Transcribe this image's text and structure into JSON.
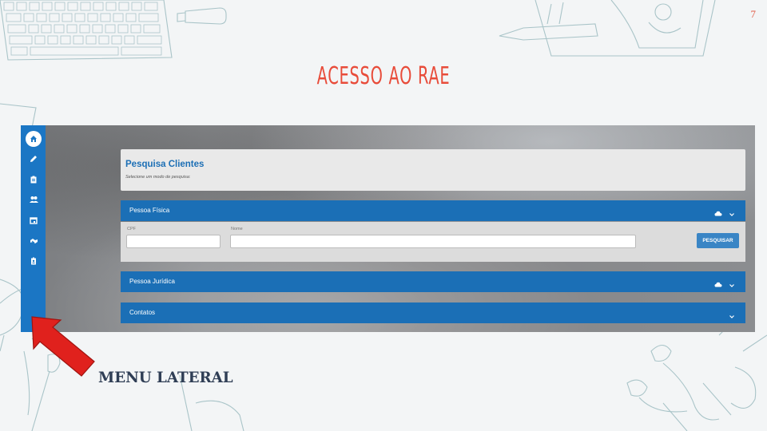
{
  "slide": {
    "number": "7",
    "title": "ACESSO AO RAE",
    "caption": "MENU LATERAL"
  },
  "sidebar": {
    "items": [
      {
        "icon": "home-icon"
      },
      {
        "icon": "pencil-icon"
      },
      {
        "icon": "clipboard-icon"
      },
      {
        "icon": "people-icon"
      },
      {
        "icon": "calendar-icon"
      },
      {
        "icon": "handshake-icon"
      },
      {
        "icon": "badge-icon"
      }
    ]
  },
  "search_panel": {
    "title": "Pesquisa Clientes",
    "subtitle": "Selecione um modo de pesquisa:"
  },
  "sections": {
    "pessoa_fisica": "Pessoa Física",
    "pessoa_juridica": "Pessoa Jurídica",
    "contatos": "Contatos"
  },
  "form": {
    "cpf_label": "CPF",
    "cpf_value": "",
    "nome_label": "Nome",
    "nome_value": "",
    "search_button": "PESQUISAR"
  },
  "colors": {
    "sidebar": "#1b76c4",
    "section_bar": "#1b6fb6",
    "title": "#e84c3a",
    "arrow": "#e0211d"
  }
}
